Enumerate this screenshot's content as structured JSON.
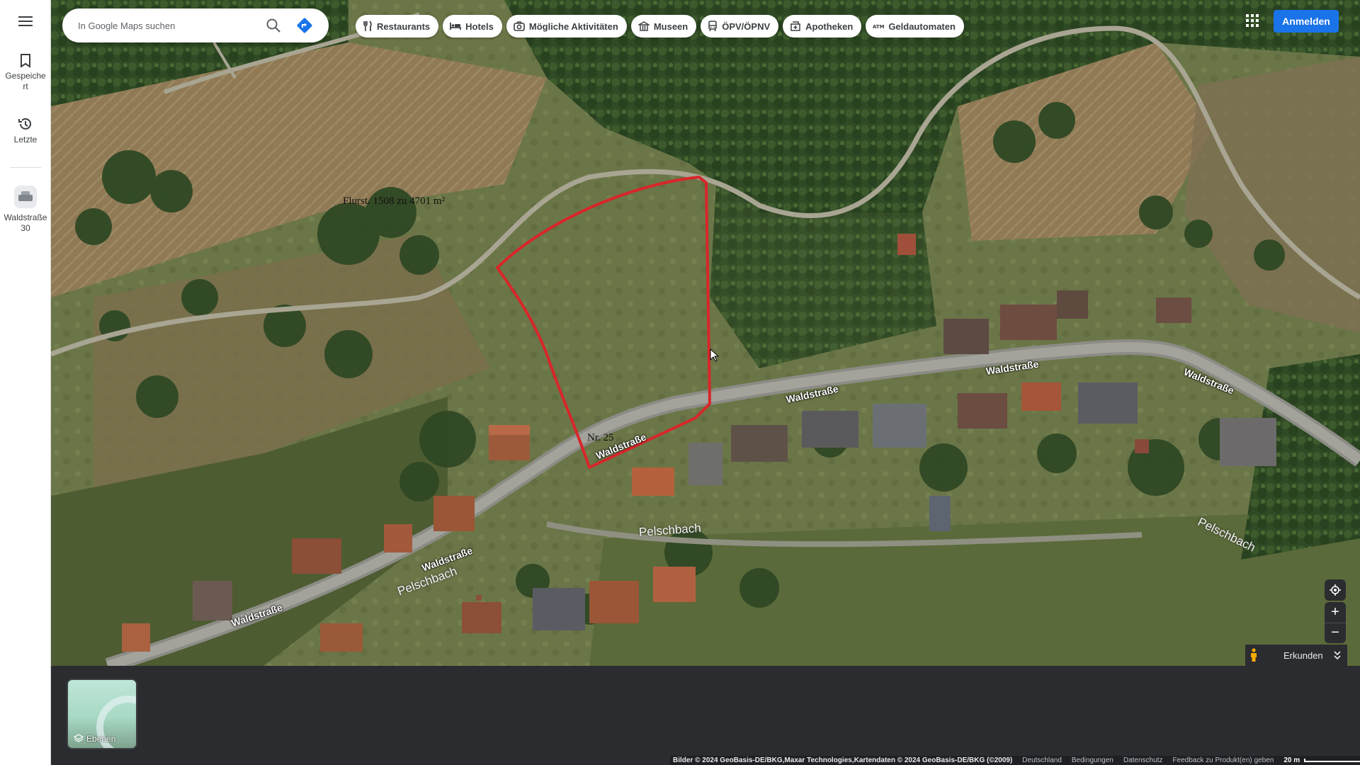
{
  "rail": {
    "menu_icon": "hamburger-menu-icon",
    "saved_label": "Gespeichert",
    "recent_label": "Letzte",
    "place_label": "Waldstraße 30"
  },
  "search": {
    "placeholder": "In Google Maps suchen",
    "value": ""
  },
  "chips": [
    {
      "label": "Restaurants",
      "icon": "fork-knife-icon"
    },
    {
      "label": "Hotels",
      "icon": "bed-icon"
    },
    {
      "label": "Mögliche Aktivitäten",
      "icon": "camera-icon"
    },
    {
      "label": "Museen",
      "icon": "museum-icon"
    },
    {
      "label": "ÖPV/ÖPNV",
      "icon": "transit-icon"
    },
    {
      "label": "Apotheken",
      "icon": "pharmacy-icon"
    },
    {
      "label": "Geldautomaten",
      "icon": "atm-icon"
    }
  ],
  "header": {
    "signin_label": "Anmelden",
    "accent_color": "#1a73e8"
  },
  "map": {
    "parcel_label": "Flurst. 1508 zu 4701 m²",
    "house_number_label": "Nr. 25",
    "street_labels": [
      "Waldstraße",
      "Waldstraße",
      "Waldstraße",
      "Waldstraße",
      "Waldstraße",
      "Waldstraße"
    ],
    "creek_labels": [
      "Pelschbach",
      "Pelschbach",
      "Pelschbach"
    ],
    "parcel_outline_color": "#d8262a"
  },
  "controls": {
    "zoom_in": "+",
    "zoom_out": "−",
    "explore_label": "Erkunden"
  },
  "layers": {
    "label": "Ebenen"
  },
  "footer": {
    "attribution": "Bilder © 2024 GeoBasis-DE/BKG,Maxar Technologies,Kartendaten © 2024 GeoBasis-DE/BKG (©2009)",
    "country": "Deutschland",
    "terms": "Bedingungen",
    "privacy": "Datenschutz",
    "feedback": "Feedback zu Produkt(en) geben",
    "scale": "20 m"
  }
}
